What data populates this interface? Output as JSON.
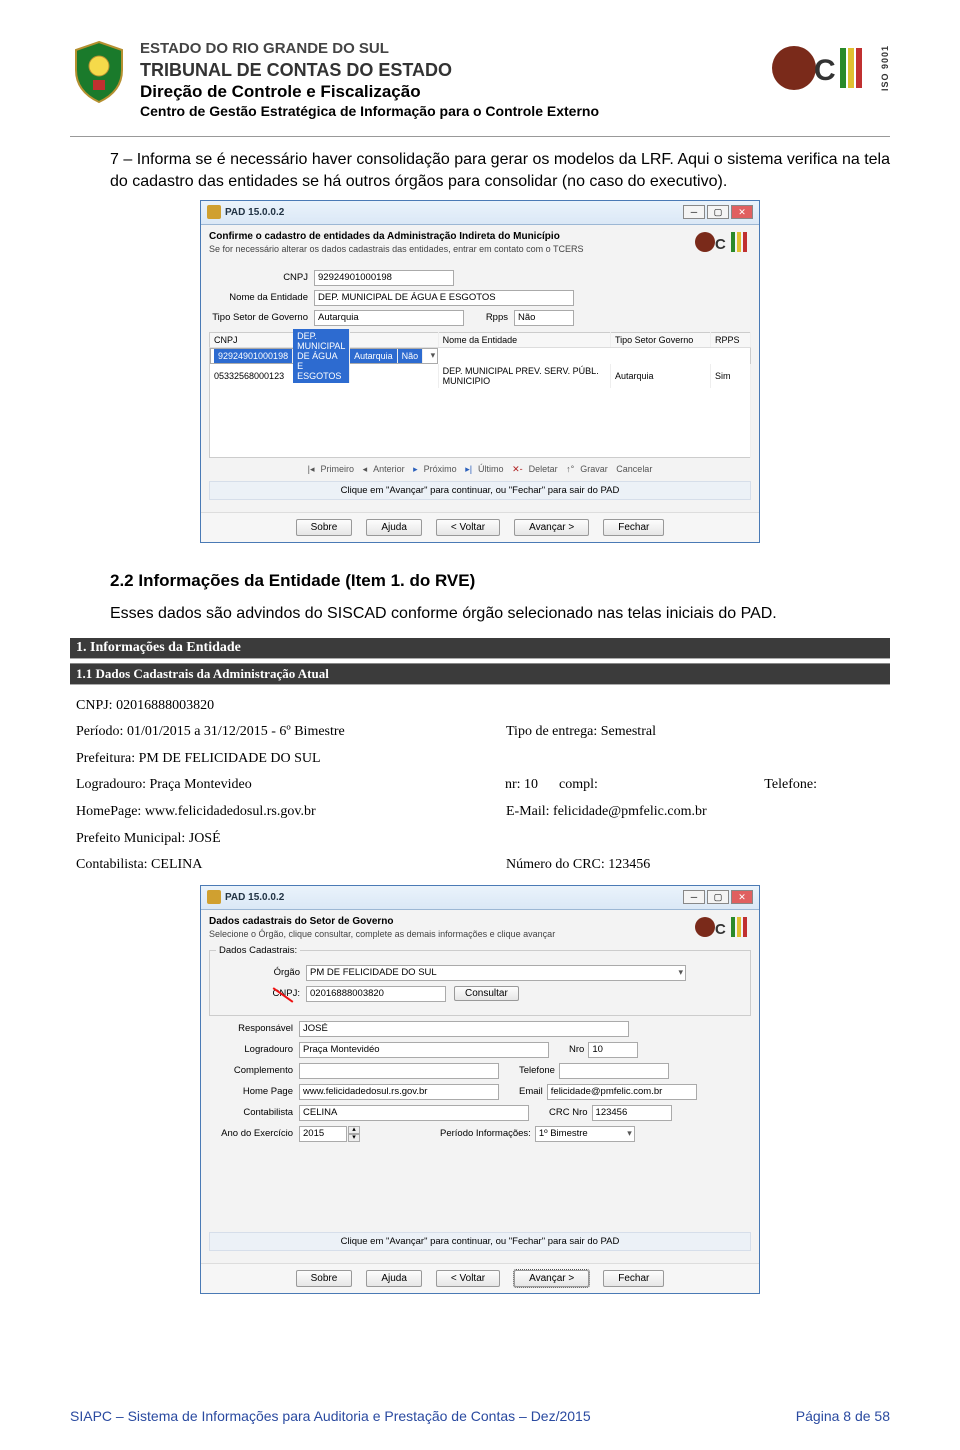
{
  "header": {
    "state": "ESTADO DO RIO GRANDE DO SUL",
    "tribunal": "TRIBUNAL DE CONTAS DO ESTADO",
    "direcao": "Direção de Controle e Fiscalização",
    "centro": "Centro de Gestão Estratégica de Informação para o Controle Externo",
    "iso": "ISO 9001"
  },
  "body": {
    "p1a": "7 – Informa se é necessário haver consolidação para gerar os modelos da LRF. Aqui o sistema verifica na tela do cadastro das entidades se há outros órgãos para consolidar (no caso do executivo).",
    "sec22": "2.2    Informações da Entidade (Item 1. do RVE)",
    "p2": "Esses dados são advindos do SISCAD conforme órgão selecionado nas telas iniciais do PAD."
  },
  "dlg1": {
    "title": "PAD 15.0.0.2",
    "heading": "Confirme o cadastro de entidades da Administração Indireta do Município",
    "sub": "Se for necessário alterar os dados cadastrais das entidades, entrar em contato com o TCERS",
    "cnpj_lbl": "CNPJ",
    "cnpj": "92924901000198",
    "nome_lbl": "Nome da Entidade",
    "nome": "DEP. MUNICIPAL DE ÁGUA E ESGOTOS",
    "tipo_lbl": "Tipo Setor de Governo",
    "tipo": "Autarquia",
    "rpps_lbl": "Rpps",
    "rpps": "Não",
    "cols": {
      "c0": "CNPJ",
      "c1": "Nome da Entidade",
      "c2": "Tipo Setor Governo",
      "c3": "RPPS"
    },
    "row1": {
      "c0": "92924901000198",
      "c1": "DEP. MUNICIPAL DE ÁGUA E ESGOTOS",
      "c2": "Autarquia",
      "c3": "Não"
    },
    "row2": {
      "c0": "05332568000123",
      "c1": "DEP. MUNICIPAL PREV. SERV. PÚBL. MUNICIPIO",
      "c2": "Autarquia",
      "c3": "Sim"
    },
    "nav": {
      "primeiro": "Primeiro",
      "anterior": "Anterior",
      "proximo": "Próximo",
      "ultimo": "Último",
      "deletar": "Deletar",
      "gravar": "Gravar",
      "cancelar": "Cancelar"
    },
    "hint": "Clique em \"Avançar\" para continuar, ou \"Fechar\" para sair do PAD",
    "btns": {
      "sobre": "Sobre",
      "ajuda": "Ajuda",
      "voltar": "< Voltar",
      "avancar": "Avançar >",
      "fechar": "Fechar"
    }
  },
  "info": {
    "band1": "1. Informações da Entidade",
    "band2": "1.1 Dados Cadastrais da Administração Atual",
    "cnpj": "CNPJ: 02016888003820",
    "periodo": "Período: 01/01/2015 a 31/12/2015 - 6º Bimestre",
    "entrega": "Tipo de entrega: Semestral",
    "prefeitura": "Prefeitura: PM DE  FELICIDADE DO SUL",
    "logradouro": "Logradouro: Praça Montevideo",
    "nr": "nr: 10",
    "compl": "compl:",
    "tel": "Telefone:",
    "homepage": "HomePage: www.felicidadedosul.rs.gov.br",
    "email": "E-Mail: felicidade@pmfelic.com.br",
    "prefeito": "Prefeito Municipal: JOSÉ",
    "contab": "Contabilista: CELINA",
    "crc": "Número do CRC: 123456"
  },
  "dlg2": {
    "title": "PAD 15.0.0.2",
    "heading": "Dados cadastrais do Setor de Governo",
    "sub": "Selecione o Órgão, clique consultar, complete as demais informações e clique avançar",
    "groupbox": "Dados Cadastrais:",
    "orgao_lbl": "Órgão",
    "orgao": "PM DE FELICIDADE DO SUL",
    "cnpj_lbl": "CNPJ:",
    "cnpj": "02016888003820",
    "consultar": "Consultar",
    "resp_lbl": "Responsável",
    "resp": "JOSÉ",
    "log_lbl": "Logradouro",
    "log": "Praça Montevidéo",
    "nro_lbl": "Nro",
    "nro": "10",
    "comp_lbl": "Complemento",
    "comp": "",
    "tel_lbl": "Telefone",
    "tel": "",
    "home_lbl": "Home Page",
    "home": "www.felicidadedosul.rs.gov.br",
    "email_lbl": "Email",
    "email": "felicidade@pmfelic.com.br",
    "cont_lbl": "Contabilista",
    "cont": "CELINA",
    "crc_lbl": "CRC Nro",
    "crc": "123456",
    "ano_lbl": "Ano do Exercício",
    "ano": "2015",
    "perinf_lbl": "Período Informações:",
    "perinf": "1º Bimestre",
    "hint": "Clique em \"Avançar\" para continuar, ou \"Fechar\" para sair do PAD",
    "btns": {
      "sobre": "Sobre",
      "ajuda": "Ajuda",
      "voltar": "< Voltar",
      "avancar": "Avançar >",
      "fechar": "Fechar"
    }
  },
  "footer": {
    "left": "SIAPC – Sistema de Informações para Auditoria e Prestação de Contas – Dez/2015",
    "right": "Página 8 de 58"
  }
}
